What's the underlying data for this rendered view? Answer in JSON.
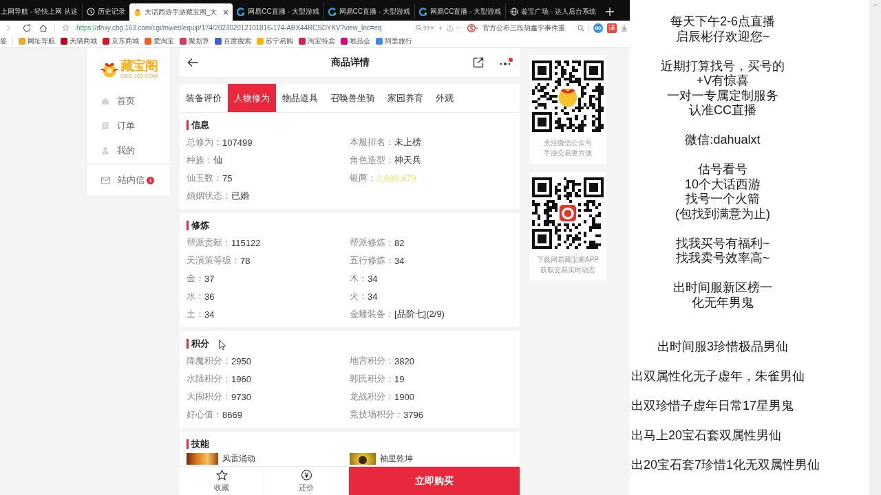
{
  "browser": {
    "tabs": [
      {
        "kind": "page",
        "title": "上网导航 - 轻快上网 从这",
        "selected": false
      },
      {
        "kind": "history",
        "title": "历史记录",
        "selected": false
      },
      {
        "kind": "cbg",
        "title": "大话西游手游藏宝阁_大",
        "selected": true
      },
      {
        "kind": "cc",
        "title": "网易CC直播 - 大型游戏",
        "selected": false
      },
      {
        "kind": "cc",
        "title": "网易CC直播 - 大型游戏",
        "selected": false
      },
      {
        "kind": "cc",
        "title": "网易CC直播 - 大型游戏",
        "selected": false
      },
      {
        "kind": "globe",
        "title": "鉴宝广场 - 达人后台系统",
        "selected": false
      }
    ],
    "address": {
      "scheme": "https://",
      "rest": "dhxy.cbg.163.com/cgi/mweb/equip/174/202302012101816-174-ABX44RCSDYKV?view_loc=eq"
    },
    "zoom": "95%",
    "search": {
      "placeholder": "官方公布三段胡鑫宇事件重"
    },
    "translate": "译",
    "bookmarks_label": "签",
    "bookmarks": [
      {
        "title": "网址导航",
        "color": "#f5a623"
      },
      {
        "title": "天猫商城",
        "color": "#c4001a"
      },
      {
        "title": "京东商城",
        "color": "#d7161e"
      },
      {
        "title": "爱淘宝",
        "color": "#ff5a1f"
      },
      {
        "title": "聚划算",
        "color": "#e8335a"
      },
      {
        "title": "百度搜索",
        "color": "#3d5fd8"
      },
      {
        "title": "苏宁易购",
        "color": "#f7b500"
      },
      {
        "title": "淘宝特卖",
        "color": "#d81e5b"
      },
      {
        "title": "唯品会",
        "color": "#e4007f"
      },
      {
        "title": "阿里旅行",
        "color": "#3b8cf0"
      }
    ]
  },
  "sidebar": {
    "logo": {
      "title": "藏宝阁",
      "subtitle": "CBG.163.COM"
    },
    "items": [
      {
        "kind": "home",
        "label": "首页"
      },
      {
        "kind": "orders",
        "label": "订单"
      },
      {
        "kind": "profile",
        "label": "我的"
      }
    ],
    "messages": {
      "label": "站内信",
      "badge": "1"
    }
  },
  "header": {
    "title": "商品详情"
  },
  "tabs": [
    {
      "label": "装备评价",
      "selected": false
    },
    {
      "label": "人物修为",
      "selected": true
    },
    {
      "label": "物品道具",
      "selected": false
    },
    {
      "label": "召唤兽坐骑",
      "selected": false
    },
    {
      "label": "家园养育",
      "selected": false
    },
    {
      "label": "外观",
      "selected": false
    }
  ],
  "sections": [
    {
      "title": "信息",
      "fields": [
        {
          "label": "总修为：",
          "value": "107499"
        },
        {
          "label": "本服排名：",
          "value": "未上榜"
        },
        {
          "label": "种族：",
          "value": "仙"
        },
        {
          "label": "角色造型：",
          "value": "神天兵"
        },
        {
          "label": "仙玉数：",
          "value": "75"
        },
        {
          "label": "银两：",
          "value": "2,680,679",
          "color": "#e2ec6a"
        },
        {
          "label": "婚姻状态：",
          "value": "已婚"
        }
      ]
    },
    {
      "title": "修炼",
      "fields": [
        {
          "label": "帮派贡献：",
          "value": "115122"
        },
        {
          "label": "帮派修炼：",
          "value": "82"
        },
        {
          "label": "天演策等级：",
          "value": "78"
        },
        {
          "label": "五行修炼：",
          "value": "34"
        },
        {
          "label": "金：",
          "value": "37"
        },
        {
          "label": "木：",
          "value": "34"
        },
        {
          "label": "水：",
          "value": "36"
        },
        {
          "label": "火：",
          "value": "34"
        },
        {
          "label": "土：",
          "value": "34"
        },
        {
          "label": "金蟠装备：",
          "value": "[品阶七](2/9)"
        }
      ]
    },
    {
      "title": "积分",
      "fields": [
        {
          "label": "降魔积分：",
          "value": "2950"
        },
        {
          "label": "地宫积分：",
          "value": "3820"
        },
        {
          "label": "水陆积分：",
          "value": "1960"
        },
        {
          "label": "郭氏积分：",
          "value": "19"
        },
        {
          "label": "大闹积分：",
          "value": "9730"
        },
        {
          "label": "龙战积分：",
          "value": "1900"
        },
        {
          "label": "好心值：",
          "value": "8669"
        },
        {
          "label": "竞技场积分：",
          "value": "3796"
        }
      ]
    }
  ],
  "skills": {
    "title": "技能",
    "items": [
      {
        "name": "风雷涌动"
      },
      {
        "name": "袖里乾坤"
      }
    ]
  },
  "bottom_bar": {
    "favorite": "收藏",
    "bargain": "还价",
    "buy": "立即购买"
  },
  "qr_cards": [
    {
      "kind": "wechat",
      "lines": [
        "关注微信公众号",
        "手游交易更方便"
      ]
    },
    {
      "kind": "app",
      "lines": [
        "下载网易藏宝阁APP",
        "获取交易实时动态"
      ]
    }
  ],
  "stream_notes": {
    "blocks": [
      [
        "每天下午2-6点直播",
        "启辰彬仔欢迎您~"
      ],
      [
        "近期打算找号，买号的",
        "+V有惊喜",
        "一对一专属定制服务",
        "认准CC直播"
      ],
      [
        "微信:dahualxt"
      ],
      [
        "估号看号",
        "10个大话西游",
        "找号一个火箭",
        "(包找到满意为止)"
      ],
      [
        "找我买号有福利~",
        "找我卖号效率高~"
      ],
      [
        "出时间服新区榜一",
        "化无年男鬼"
      ]
    ],
    "highlight": "出时间服3珍惜极品男仙",
    "offers": [
      "出双属性化无子虚年，朱雀男仙",
      "出双珍惜子虚年日常17星男鬼",
      "出马上20宝石套双属性男仙",
      "出20宝石套7珍惜1化无双属性男仙"
    ]
  }
}
